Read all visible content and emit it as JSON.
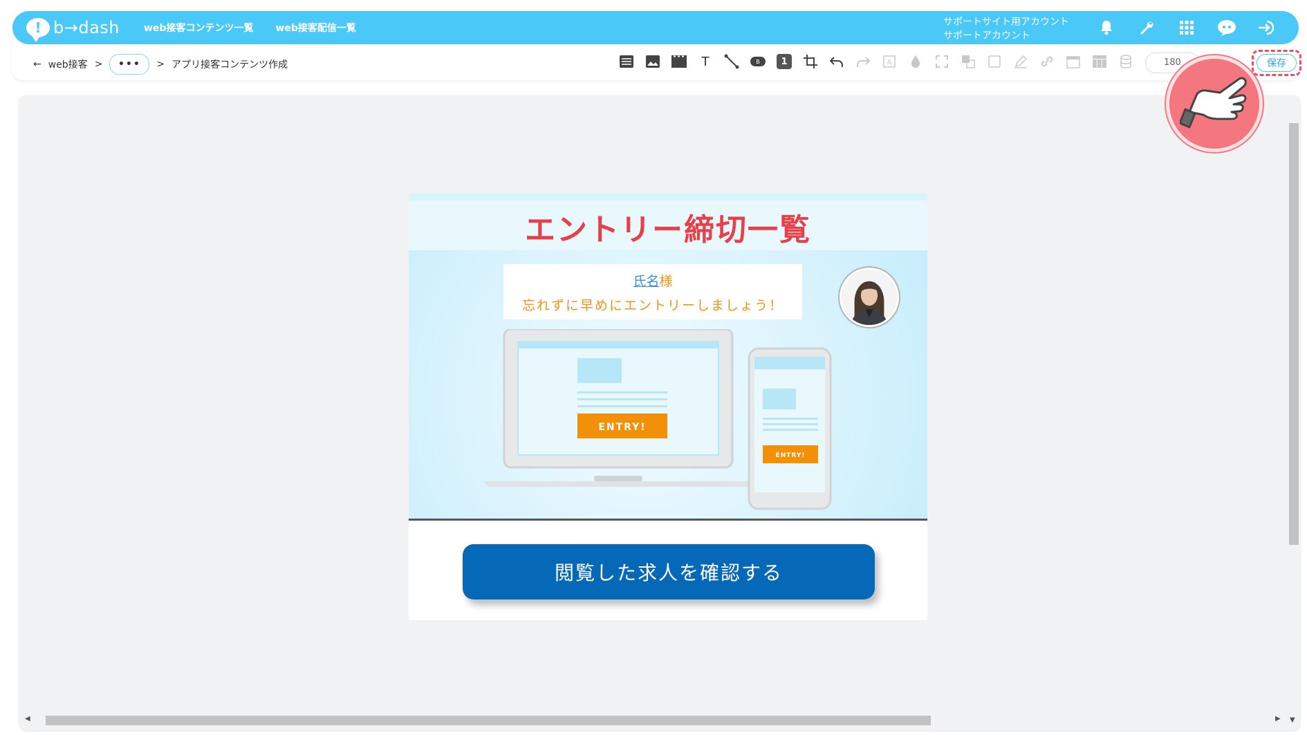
{
  "header": {
    "logo_mark": "!",
    "logo_text": "b→dash",
    "nav": [
      {
        "label": "web接客コンテンツ一覧"
      },
      {
        "label": "web接客配信一覧"
      }
    ],
    "account_line1": "サポートサイト用アカウント",
    "account_line2": "サポートアカウント",
    "icons": [
      "bell-icon",
      "wrench-icon",
      "grid-icon",
      "chat-bot-icon",
      "logout-icon"
    ]
  },
  "breadcrumb": {
    "back_arrow": "←",
    "item1": "web接客",
    "sep1": ">",
    "more": "•••",
    "sep2": ">",
    "current": "アプリ接客コンテンツ作成"
  },
  "toolbar": {
    "zoom_value": "180",
    "layer_number": "1",
    "save_label": "保存"
  },
  "content": {
    "title": "エントリー締切一覧",
    "name_placeholder": "氏名",
    "name_suffix": "様",
    "message": "忘れずに早めにエントリーしましょう！",
    "laptop_button": "ENTRY!",
    "phone_button": "ENTRY!",
    "cta_label": "閲覧した求人を確認する"
  },
  "colors": {
    "brand": "#4ac8f7",
    "title_red": "#e84048",
    "message_orange": "#f0921a",
    "cta_blue": "#0569b8",
    "entry_orange": "#f29107",
    "highlight_red": "#e94f63"
  }
}
